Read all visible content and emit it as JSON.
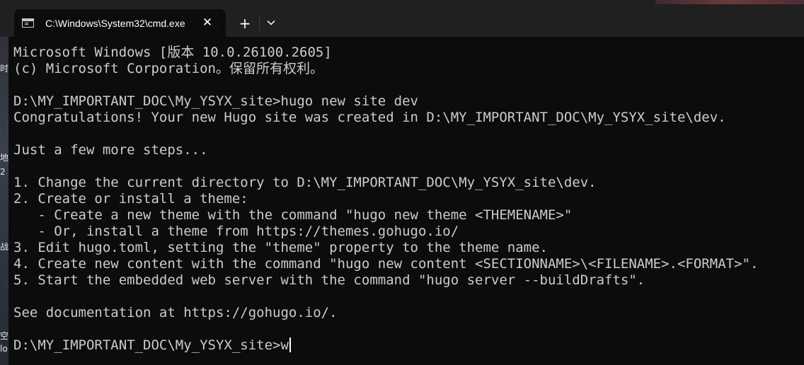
{
  "desktop_fragments": [
    "时",
    "地",
    "2",
    "战",
    "空",
    "lo"
  ],
  "tab": {
    "title": "C:\\Windows\\System32\\cmd.exe",
    "icon": "cmd-icon",
    "close_icon": "close-icon"
  },
  "toolbar": {
    "new_tab_icon": "plus-icon",
    "dropdown_icon": "chevron-down-icon"
  },
  "terminal": {
    "lines": [
      "Microsoft Windows [版本 10.0.26100.2605]",
      "(c) Microsoft Corporation。保留所有权利。",
      "",
      "D:\\MY_IMPORTANT_DOC\\My_YSYX_site>hugo new site dev",
      "Congratulations! Your new Hugo site was created in D:\\MY_IMPORTANT_DOC\\My_YSYX_site\\dev.",
      "",
      "Just a few more steps...",
      "",
      "1. Change the current directory to D:\\MY_IMPORTANT_DOC\\My_YSYX_site\\dev.",
      "2. Create or install a theme:",
      "   - Create a new theme with the command \"hugo new theme <THEMENAME>\"",
      "   - Or, install a theme from https://themes.gohugo.io/",
      "3. Edit hugo.toml, setting the \"theme\" property to the theme name.",
      "4. Create new content with the command \"hugo new content <SECTIONNAME>\\<FILENAME>.<FORMAT>\".",
      "5. Start the embedded web server with the command \"hugo server --buildDrafts\".",
      "",
      "See documentation at https://gohugo.io/.",
      "",
      "D:\\MY_IMPORTANT_DOC\\My_YSYX_site>w"
    ]
  },
  "colors": {
    "terminal_bg": "#0c0c0c",
    "terminal_fg": "#cccccc",
    "titlebar_bg": "#202020",
    "tab_bg": "#0c0c0c"
  }
}
